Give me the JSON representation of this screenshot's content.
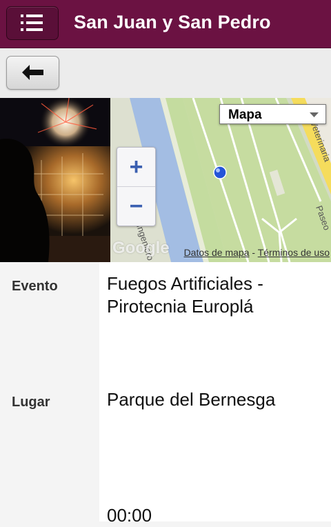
{
  "header": {
    "title": "San Juan y San Pedro",
    "menu_icon": "menu-list-icon"
  },
  "toolbar": {
    "back_icon": "arrow-left-icon"
  },
  "map": {
    "type_selector": "Mapa",
    "zoom_in": "+",
    "zoom_out": "−",
    "logo": "Google",
    "attribution_data": "Datos de mapa",
    "attribution_sep": " - ",
    "attribution_terms": "Términos de uso",
    "street_labels": [
      "Veterinaria",
      "Paseo",
      "Ingeniero"
    ]
  },
  "details": {
    "rows": [
      {
        "label": "Evento",
        "value": "Fuegos Artificiales - Pirotecnia Europlá"
      },
      {
        "label": "Lugar",
        "value": "Parque del Bernesga"
      },
      {
        "label": "",
        "value": "00:00"
      }
    ]
  },
  "colors": {
    "appbar": "#6b1242",
    "river": "#a3bde3",
    "park": "#c6dca0",
    "road_yellow": "#f5dc5c"
  }
}
